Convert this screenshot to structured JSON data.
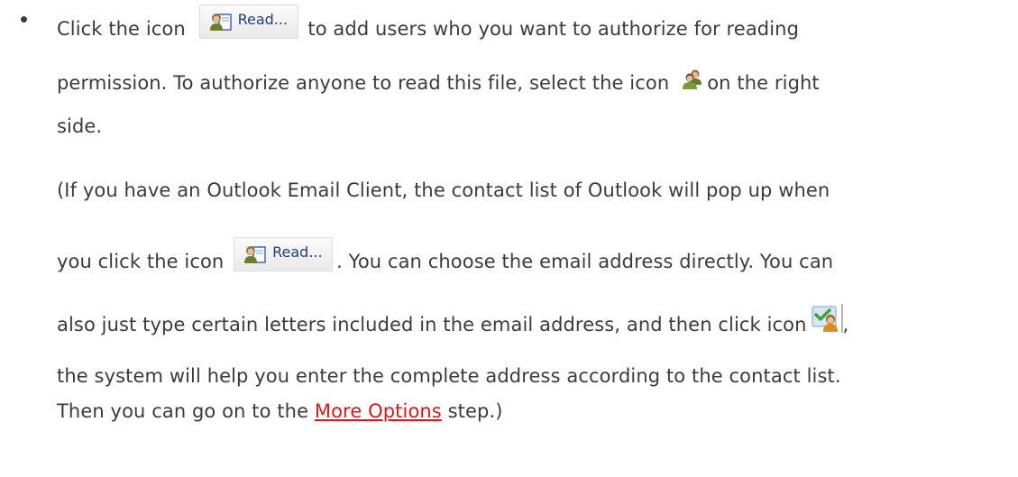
{
  "bullet": {
    "line1_before": "Click the icon",
    "read_label": "Read...",
    "line1_after": "to add users who you want to authorize for reading",
    "line2_before": "permission. To authorize anyone to read this file, select the icon",
    "line2_after": "on the right",
    "line3": "side."
  },
  "note": {
    "line1": "(If you have an Outlook Email Client, the contact list of Outlook will pop up when",
    "line2_before": "you click the icon",
    "read_label": "Read...",
    "line2_after": ". You can choose the email address directly. You can",
    "line3_before": "also just type certain letters included in the email address, and then click icon",
    "line3_after": ",",
    "line4": "the system will help you enter the complete address according to the contact list.",
    "line5_before": "Then you can go on to the",
    "link_text": "More Options",
    "line5_after": "step.)"
  },
  "colors": {
    "text": "#3b3b3b",
    "link": "#d01c1c",
    "button_label": "#1d3f7a"
  },
  "icons": {
    "read_button_icon": "user-book-icon",
    "anyone_icon": "two-users-icon",
    "resolve_icon": "check-user-icon"
  }
}
